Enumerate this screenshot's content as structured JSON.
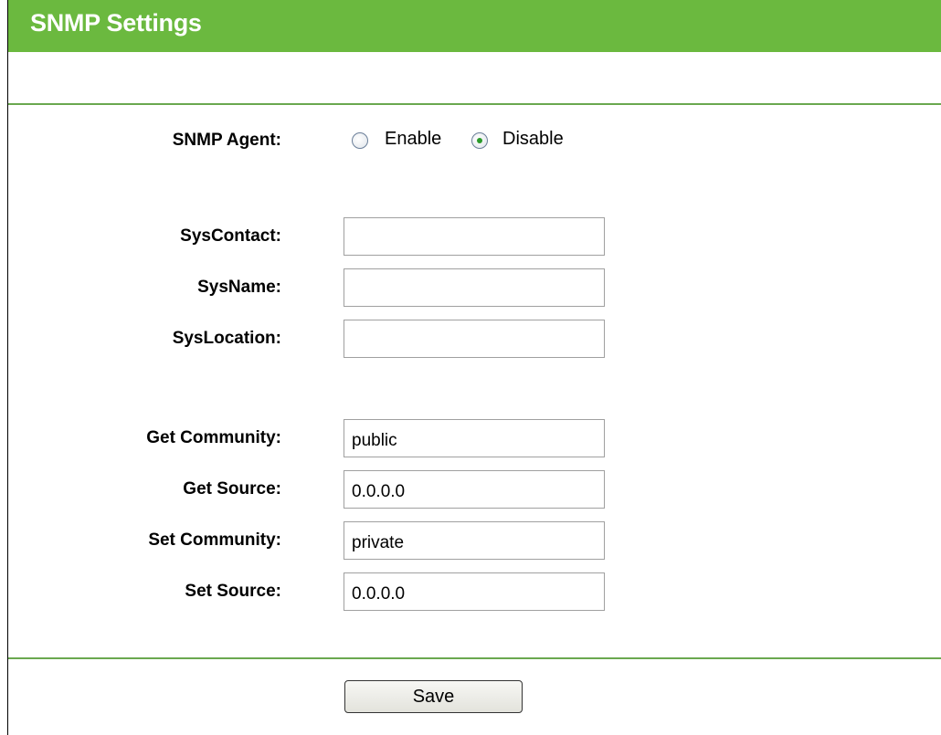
{
  "header": {
    "title": "SNMP Settings"
  },
  "colors": {
    "title_bar": "#6bb93f",
    "divider": "#6aa84f",
    "radio_selected": "#2a9a2a"
  },
  "snmp_agent": {
    "label": "SNMP Agent:",
    "options": [
      "Enable",
      "Disable"
    ],
    "selected": "Disable"
  },
  "fields": {
    "syscontact": {
      "label": "SysContact:",
      "value": ""
    },
    "sysname": {
      "label": "SysName:",
      "value": ""
    },
    "syslocation": {
      "label": "SysLocation:",
      "value": ""
    },
    "get_community": {
      "label": "Get Community:",
      "value": "public"
    },
    "get_source": {
      "label": "Get Source:",
      "value": "0.0.0.0"
    },
    "set_community": {
      "label": "Set Community:",
      "value": "private"
    },
    "set_source": {
      "label": "Set Source:",
      "value": "0.0.0.0"
    }
  },
  "actions": {
    "save_label": "Save"
  }
}
